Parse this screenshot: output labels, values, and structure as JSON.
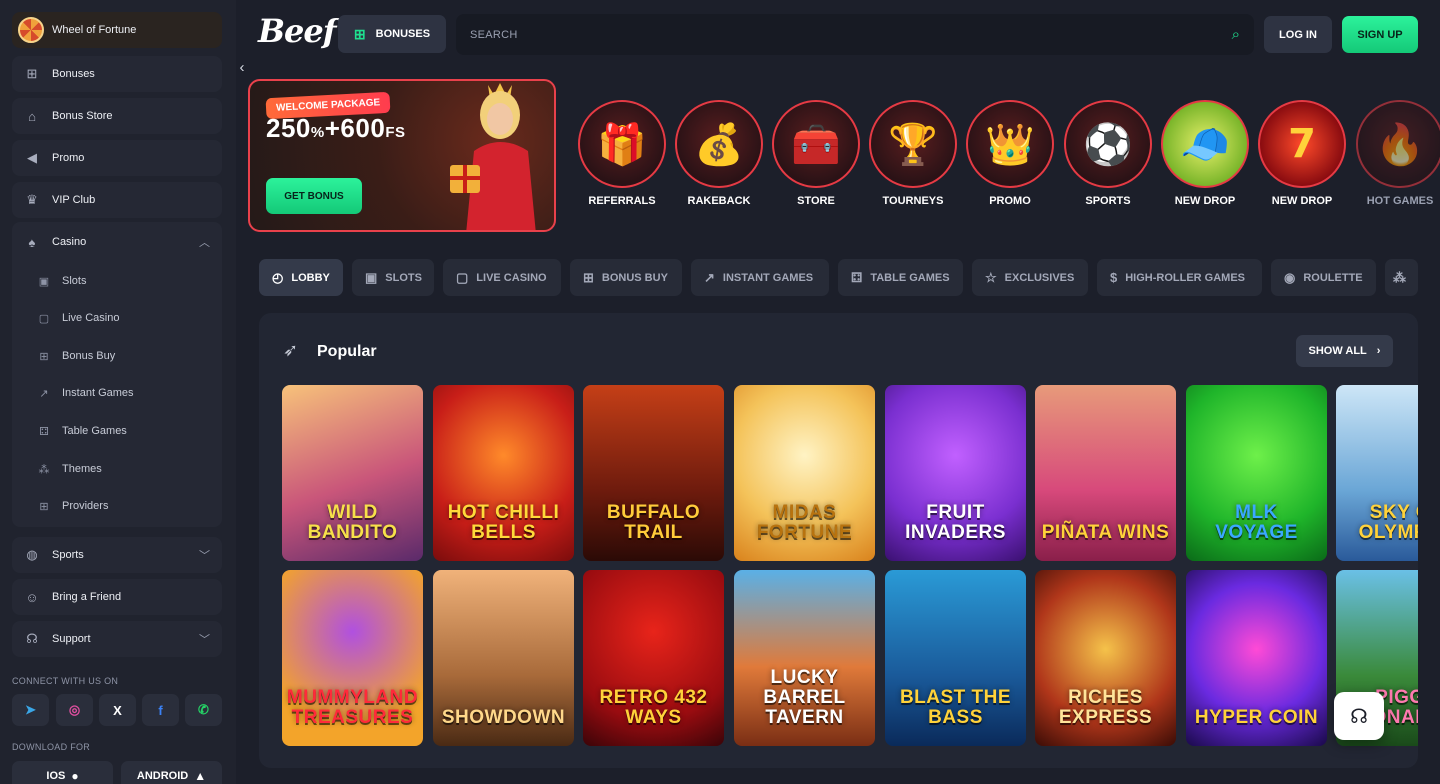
{
  "sidebar": {
    "top_items": [
      {
        "label": "Wheel of Fortune",
        "icon": "wheel-icon"
      },
      {
        "label": "Bonuses",
        "icon": "gift-icon"
      },
      {
        "label": "Bonus Store",
        "icon": "basket-icon"
      },
      {
        "label": "Promo",
        "icon": "megaphone-icon"
      },
      {
        "label": "VIP Club",
        "icon": "crown-icon"
      }
    ],
    "casino": {
      "label": "Casino",
      "icon": "cards-icon",
      "items": [
        {
          "label": "Slots",
          "icon": "slot-icon"
        },
        {
          "label": "Live Casino",
          "icon": "live-icon"
        },
        {
          "label": "Bonus Buy",
          "icon": "gift-icon"
        },
        {
          "label": "Instant Games",
          "icon": "chart-icon"
        },
        {
          "label": "Table Games",
          "icon": "dice-icon"
        },
        {
          "label": "Themes",
          "icon": "themes-icon"
        },
        {
          "label": "Providers",
          "icon": "grid-icon"
        }
      ]
    },
    "bottom_items": [
      {
        "label": "Sports",
        "icon": "ball-icon"
      },
      {
        "label": "Bring a Friend",
        "icon": "user-plus-icon"
      },
      {
        "label": "Support",
        "icon": "headset-icon"
      }
    ],
    "connect_label": "CONNECT WITH US ON",
    "socials": [
      {
        "name": "telegram-icon",
        "glyph": "➤",
        "color": "#3aa6e6"
      },
      {
        "name": "instagram-icon",
        "glyph": "◎",
        "color": "#e04fa0"
      },
      {
        "name": "x-icon",
        "glyph": "X",
        "color": "#ffffff"
      },
      {
        "name": "facebook-icon",
        "glyph": "f",
        "color": "#3b82f6"
      },
      {
        "name": "whatsapp-icon",
        "glyph": "✆",
        "color": "#25d366"
      }
    ],
    "download_label": "DOWNLOAD FOR",
    "downloads": [
      {
        "label": "IOS",
        "icon": "apple-icon",
        "glyph": ""
      },
      {
        "label": "ANDROID",
        "icon": "android-icon",
        "glyph": "🤖"
      }
    ]
  },
  "header": {
    "brand": "Beef",
    "bonuses_label": "BONUSES",
    "search_placeholder": "SEARCH",
    "login_label": "LOG IN",
    "signup_label": "SIGN UP"
  },
  "promo": {
    "tag": "WELCOME PACKAGE",
    "offer_main": "250",
    "offer_pct": "%",
    "offer_plus": "+600",
    "offer_fs": "FS",
    "button": "GET BONUS"
  },
  "categories": [
    {
      "label": "REFERRALS",
      "glyph": "🎁"
    },
    {
      "label": "RAKEBACK",
      "glyph": "💰"
    },
    {
      "label": "STORE",
      "glyph": "🧰"
    },
    {
      "label": "TOURNEYS",
      "glyph": "🏆"
    },
    {
      "label": "PROMO",
      "glyph": "👑"
    },
    {
      "label": "SPORTS",
      "glyph": "⚽"
    },
    {
      "label": "NEW DROP",
      "glyph": "🧢"
    },
    {
      "label": "NEW DROP",
      "glyph": "7"
    },
    {
      "label": "HOT GAMES",
      "glyph": "🔥"
    }
  ],
  "tabs": [
    {
      "label": "LOBBY",
      "icon": "lobby-icon",
      "glyph": "◴"
    },
    {
      "label": "SLOTS",
      "icon": "slot-icon",
      "glyph": "▣"
    },
    {
      "label": "LIVE CASINO",
      "icon": "live-icon",
      "glyph": "▢"
    },
    {
      "label": "BONUS BUY",
      "icon": "gift-icon",
      "glyph": "⊞"
    },
    {
      "label": "INSTANT GAMES",
      "icon": "chart-icon",
      "glyph": "↗"
    },
    {
      "label": "TABLE GAMES",
      "icon": "dice-icon",
      "glyph": "⚃"
    },
    {
      "label": "EXCLUSIVES",
      "icon": "star-icon",
      "glyph": "☆"
    },
    {
      "label": "HIGH-ROLLER GAMES",
      "icon": "dollar-icon",
      "glyph": "$"
    },
    {
      "label": "ROULETTE",
      "icon": "roulette-icon",
      "glyph": "◉"
    },
    {
      "label": "",
      "icon": "themes-icon",
      "glyph": "⁂"
    }
  ],
  "popular": {
    "title": "Popular",
    "show_all": "SHOW ALL",
    "games_row1": [
      {
        "title": "WILD BANDITO",
        "bg": "linear-gradient(160deg,#f7c27a,#c9567a 55%,#5a2a6a)",
        "color": "#f7e04a"
      },
      {
        "title": "Hot Chilli Bells",
        "bg": "radial-gradient(circle at 50% 40%,#ff8a2a,#c81e18 60%,#7a0c0c)",
        "color": "#ffd93a"
      },
      {
        "title": "BUFFALO TRAIL",
        "bg": "linear-gradient(180deg,#c53f17,#6e1b0d 60%,#2b0a06)",
        "color": "#ffcc3a"
      },
      {
        "title": "MIDAS FORTUNE",
        "bg": "radial-gradient(circle at 50% 40%,#fff3c4,#f4c35a 55%,#d9821c)",
        "color": "#b8730f"
      },
      {
        "title": "FRUIT INVADERS",
        "bg": "radial-gradient(circle at 50% 40%,#c160ff,#7a2fd0 60%,#3a1070)",
        "color": "#ffffff"
      },
      {
        "title": "Piñata WINS",
        "bg": "linear-gradient(180deg,#e79a7a,#d7497b 60%,#8a1f4a)",
        "color": "#ffd23a"
      },
      {
        "title": "MLK VOYAGE",
        "bg": "radial-gradient(circle at 50% 40%,#6ef04a,#1fb52a 60%,#0a6a18)",
        "color": "#3aa8ff"
      },
      {
        "title": "SKY OF OLYMPUS",
        "bg": "linear-gradient(180deg,#cde6f7,#6aa6d6 60%,#2a5a9a)",
        "color": "#ffd23a"
      }
    ],
    "games_row2": [
      {
        "title": "MUMMYLAND TREASURES",
        "bg": "radial-gradient(circle at 50% 35%,#b050e0,#f3a42a 70%)",
        "color": "#ff2a3a"
      },
      {
        "title": "SHOWDOWN",
        "bg": "linear-gradient(180deg,#f0b27a,#a86a3a 60%,#4a2a14)",
        "color": "#ffd88a"
      },
      {
        "title": "RETRO 432 WAYS",
        "bg": "radial-gradient(circle at 50% 35%,#e8241a,#9a0c10 65%,#3a0408)",
        "color": "#ffd23a"
      },
      {
        "title": "LUCKY BARREL TAVERN",
        "bg": "linear-gradient(180deg,#5ab0e6,#e07a3a 55%,#7a2e14)",
        "color": "#ffffff"
      },
      {
        "title": "BLAST THE BASS",
        "bg": "linear-gradient(180deg,#2a9ad6,#1a5a9a 60%,#0a2a5a)",
        "color": "#ffd23a"
      },
      {
        "title": "RICHES EXPRESS",
        "bg": "radial-gradient(circle at 50% 45%,#f5c24a,#b0361a 60%,#3a0c06)",
        "color": "#ffe49a"
      },
      {
        "title": "HYPER COIN",
        "bg": "radial-gradient(circle at 50% 45%,#ff4ad6,#6a2ae0 55%,#1a0a4a)",
        "color": "#ffd23a"
      },
      {
        "title": "PIGGY BONANZA",
        "bg": "linear-gradient(180deg,#6ac0e6,#3a8a3a 60%,#1a4a1a)",
        "color": "#ff7ab0"
      }
    ]
  },
  "colors": {
    "accent_green": "#1fe08f",
    "accent_red": "#e53a44",
    "bg": "#1c1f2a",
    "sidebar": "#20232e"
  }
}
